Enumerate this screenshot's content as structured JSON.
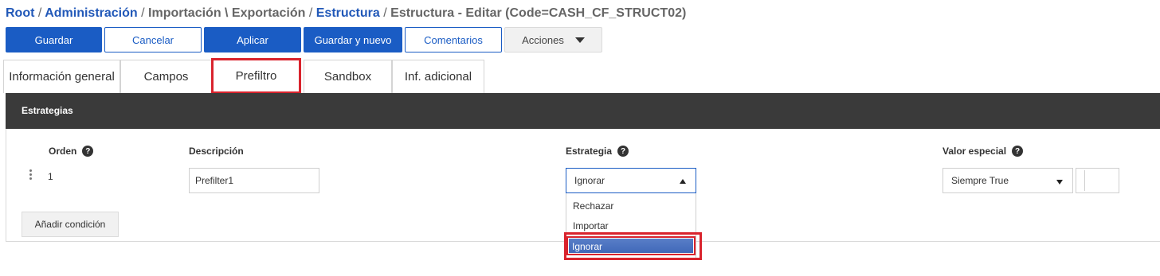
{
  "breadcrumb": {
    "root": "Root",
    "administracion": "Administración",
    "importacion": "Importación \\ Exportación",
    "estructura": "Estructura",
    "current": "Estructura - Editar (Code=CASH_CF_STRUCT02)",
    "separator": "/"
  },
  "toolbar": {
    "guardar": "Guardar",
    "cancelar": "Cancelar",
    "aplicar": "Aplicar",
    "guardar_nuevo": "Guardar y nuevo",
    "comentarios": "Comentarios",
    "acciones": "Acciones"
  },
  "tabs": [
    {
      "label": "Información general"
    },
    {
      "label": "Campos"
    },
    {
      "label": "Prefiltro",
      "active": true
    },
    {
      "label": "Sandbox"
    },
    {
      "label": "Inf. adicional"
    }
  ],
  "panel": {
    "title": "Estrategias",
    "columns": {
      "orden": "Orden",
      "descripcion": "Descripción",
      "estrategia": "Estrategia",
      "valor_especial": "Valor especial"
    },
    "help_symbol": "?"
  },
  "row": {
    "orden": "1",
    "descripcion": "Prefilter1",
    "estrategia": "Ignorar",
    "valor_especial": "Siempre True"
  },
  "estrategia_options": [
    "Rechazar",
    "Importar",
    "Ignorar"
  ],
  "add_condition": "Añadir condición",
  "colors": {
    "primary": "#1a5cc4",
    "link": "#2158b8",
    "header_bg": "#3a3a3a",
    "highlight_red": "#d9232d",
    "selected_option": "#4a70be"
  }
}
